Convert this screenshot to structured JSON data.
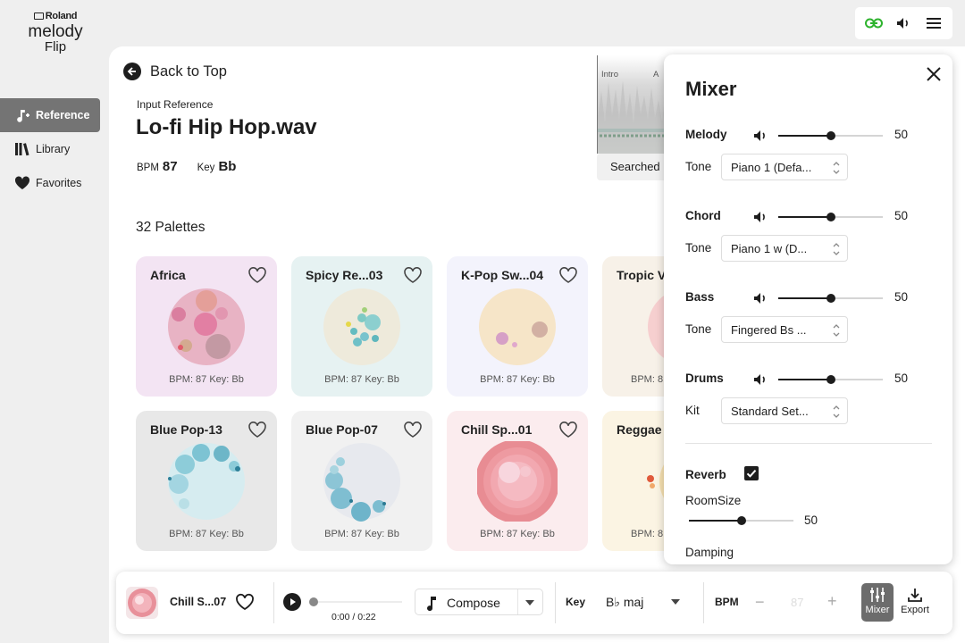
{
  "app": {
    "brand": "Roland",
    "logo_line1": "melody",
    "logo_line2": "Flip"
  },
  "sidebar": {
    "items": [
      {
        "label": "Reference",
        "icon": "music-note-plus-icon",
        "active": true
      },
      {
        "label": "Library",
        "icon": "library-books-icon",
        "active": false
      },
      {
        "label": "Favorites",
        "icon": "heart-icon",
        "active": false
      }
    ]
  },
  "topbar": {
    "icons": [
      "link-icon",
      "speaker-icon",
      "menu-icon"
    ],
    "link_color": "#2db32d"
  },
  "main": {
    "back_label": "Back to Top",
    "input_reference_label": "Input Reference",
    "title": "Lo-fi Hip Hop.wav",
    "bpm_label": "BPM",
    "bpm_value": "87",
    "key_label": "Key",
    "key_value": "Bb",
    "palettes_count": "32 Palettes",
    "waveform": {
      "intro_label": "Intro",
      "section_label": "A"
    },
    "searched_label": "Searched"
  },
  "palettes": [
    {
      "name": "Africa",
      "footer": "BPM: 87  Key: Bb",
      "bg": "#f3e4f3"
    },
    {
      "name": "Spicy Re...03",
      "footer": "BPM: 87  Key: Bb",
      "bg": "#e6f2f2"
    },
    {
      "name": "K-Pop Sw...04",
      "footer": "BPM: 87  Key: Bb",
      "bg": "#f3f3fc"
    },
    {
      "name": "Tropic V",
      "footer": "BPM: 8",
      "bg": "#f7f1e8"
    },
    {
      "name": "Blue Pop-13",
      "footer": "BPM: 87  Key: Bb",
      "bg": "#e8e8e8"
    },
    {
      "name": "Blue Pop-07",
      "footer": "BPM: 87  Key: Bb",
      "bg": "#f1f1f1"
    },
    {
      "name": "Chill Sp...01",
      "footer": "BPM: 87  Key: Bb",
      "bg": "#fbecee"
    },
    {
      "name": "Reggae",
      "footer": "BPM: 8",
      "bg": "#fbf4e3"
    }
  ],
  "mixer": {
    "title": "Mixer",
    "channels": [
      {
        "label": "Melody",
        "level": 50,
        "value": "50",
        "tone_label": "Tone",
        "tone": "Piano 1 (Defa..."
      },
      {
        "label": "Chord",
        "level": 50,
        "value": "50",
        "tone_label": "Tone",
        "tone": "Piano 1 w (D..."
      },
      {
        "label": "Bass",
        "level": 50,
        "value": "50",
        "tone_label": "Tone",
        "tone": "Fingered Bs ..."
      },
      {
        "label": "Drums",
        "level": 50,
        "value": "50",
        "tone_label": "Kit",
        "tone": "Standard Set..."
      }
    ],
    "reverb_label": "Reverb",
    "reverb_checked": true,
    "roomsize_label": "RoomSize",
    "roomsize_value": "50",
    "roomsize_level": 50,
    "damping_label": "Damping"
  },
  "player": {
    "track_name": "Chill S...07",
    "time": "0:00 / 0:22",
    "compose_label": "Compose",
    "key_label": "Key",
    "key_value": "B♭ maj",
    "bpm_label": "BPM",
    "bpm_value": "87",
    "minus": "−",
    "plus": "+",
    "mixer_label": "Mixer",
    "export_label": "Export"
  }
}
